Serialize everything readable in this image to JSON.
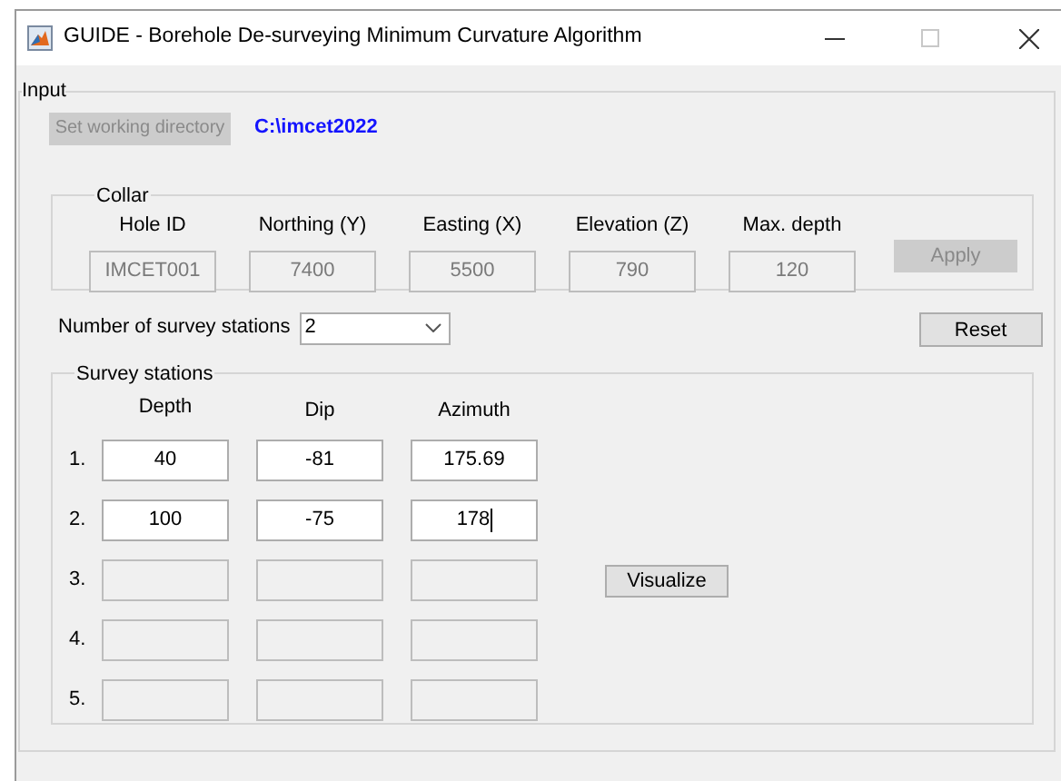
{
  "window": {
    "title": "GUIDE - Borehole De-surveying Minimum Curvature Algorithm"
  },
  "input": {
    "legend": "Input",
    "set_directory_button": {
      "label": "Set working directory",
      "disabled": true
    },
    "directory_path": "C:\\imcet2022",
    "collar": {
      "legend": "Collar",
      "fields": [
        {
          "label": "Hole ID",
          "value": "IMCET001",
          "disabled": true
        },
        {
          "label": "Northing (Y)",
          "value": "7400",
          "disabled": true
        },
        {
          "label": "Easting (X)",
          "value": "5500",
          "disabled": true
        },
        {
          "label": "Elevation (Z)",
          "value": "790",
          "disabled": true
        },
        {
          "label": "Max. depth",
          "value": "120",
          "disabled": true
        }
      ],
      "apply_button": {
        "label": "Apply",
        "disabled": true
      }
    },
    "stations_count": {
      "label": "Number of survey stations",
      "value": "2"
    },
    "reset_button": {
      "label": "Reset",
      "disabled": false
    },
    "survey_stations": {
      "legend": "Survey stations",
      "columns": [
        "Depth",
        "Dip",
        "Azimuth"
      ],
      "rows": [
        {
          "index": "1.",
          "disabled": false,
          "cells": [
            {
              "value": "40"
            },
            {
              "value": "-81"
            },
            {
              "value": "175.69"
            }
          ]
        },
        {
          "index": "2.",
          "disabled": false,
          "cells": [
            {
              "value": "100"
            },
            {
              "value": "-75"
            },
            {
              "value": "178",
              "caret": true
            }
          ]
        },
        {
          "index": "3.",
          "disabled": true,
          "cells": [
            {},
            {},
            {}
          ]
        },
        {
          "index": "4.",
          "disabled": true,
          "cells": [
            {},
            {},
            {}
          ]
        },
        {
          "index": "5.",
          "disabled": true,
          "cells": [
            {},
            {},
            {}
          ]
        }
      ],
      "visualize_button": {
        "label": "Visualize",
        "disabled": false
      }
    }
  }
}
